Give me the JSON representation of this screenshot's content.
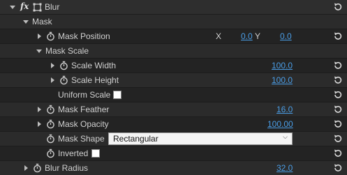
{
  "effect": {
    "fx_label": "fx",
    "title": "Blur"
  },
  "mask_group": {
    "label": "Mask"
  },
  "mask_position": {
    "label": "Mask Position",
    "x_label": "X",
    "x_value": "0.0",
    "y_label": "Y",
    "y_value": "0.0"
  },
  "mask_scale": {
    "label": "Mask Scale"
  },
  "scale_width": {
    "label": "Scale Width",
    "value": "100.0"
  },
  "scale_height": {
    "label": "Scale Height",
    "value": "100.0"
  },
  "uniform_scale": {
    "label": "Uniform Scale",
    "checked": false
  },
  "mask_feather": {
    "label": "Mask Feather",
    "value": "16.0"
  },
  "mask_opacity": {
    "label": "Mask Opacity",
    "value": "100.00"
  },
  "mask_shape": {
    "label": "Mask Shape",
    "selected": "Rectangular"
  },
  "inverted": {
    "label": "Inverted",
    "checked": false
  },
  "blur_radius": {
    "label": "Blur Radius",
    "value": "32.0"
  },
  "colors": {
    "link": "#4a9de6",
    "background": "#232323",
    "text": "#d0d0d0"
  },
  "icons": {
    "stopwatch": "stopwatch-icon",
    "reset": "reset-icon",
    "transform": "transform-icon"
  }
}
